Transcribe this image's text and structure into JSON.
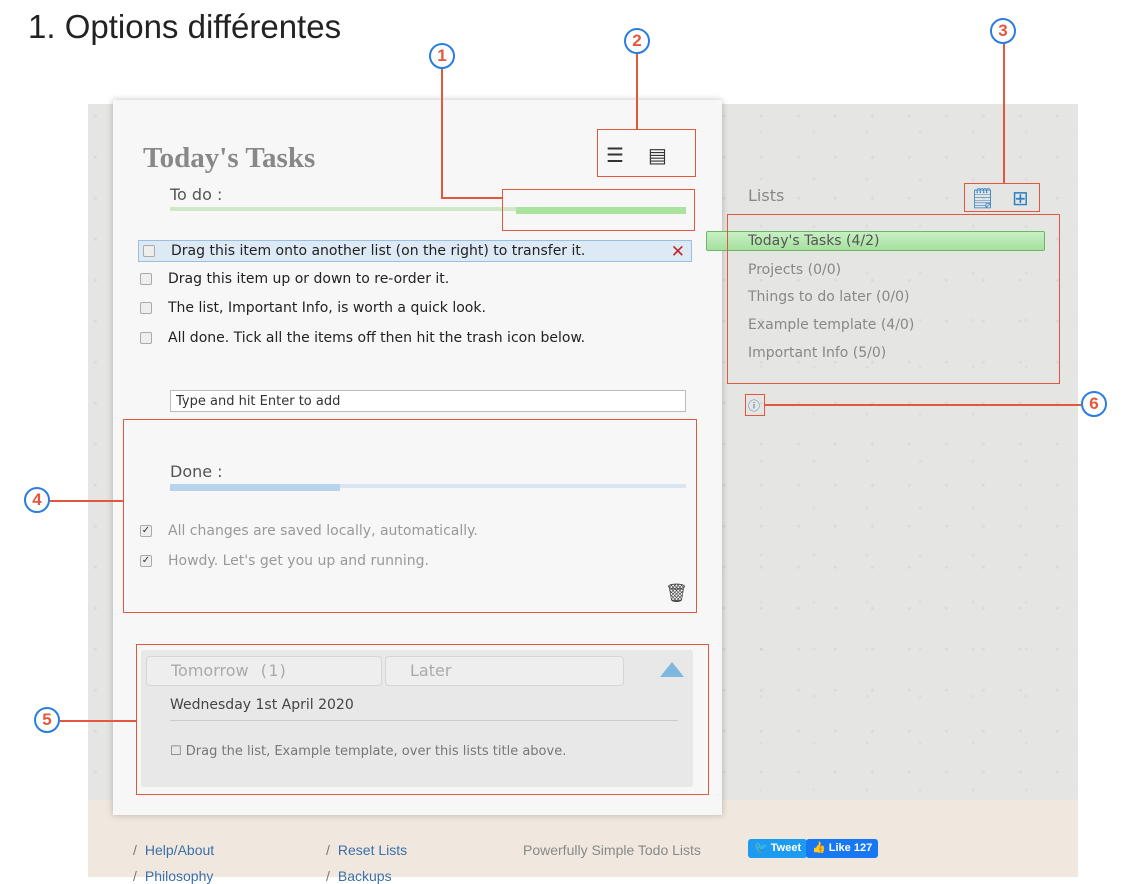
{
  "heading": "1. Options différentes",
  "panel": {
    "title": "Today's Tasks",
    "todo_label": "To do :",
    "done_label": "Done :",
    "todo_items": [
      "Drag this item onto another list (on the right) to transfer it.",
      "Drag this item up or down to re-order it.",
      "The list, Important Info, is worth a quick look.",
      "All done. Tick all the items off then hit the trash icon below."
    ],
    "done_items": [
      "All changes are saved locally, automatically.",
      "Howdy. Let's get you up and running."
    ],
    "add_value": "Type and hit Enter to add"
  },
  "icons": {
    "list_view": "list-view-icon",
    "print_view": "print-view-icon",
    "delete": "close-icon",
    "trash": "trash-icon",
    "info": "info-icon",
    "add_list": "add-list-icon",
    "add_template": "add-template-icon"
  },
  "lists": {
    "header": "Lists",
    "items": [
      "Today's Tasks (4/2)",
      "Projects (0/0)",
      "Things to do later (0/0)",
      "Example template (4/0)",
      "Important Info (5/0)"
    ]
  },
  "schedule": {
    "tab_tomorrow": "Tomorrow",
    "tab_tomorrow_count": "(1)",
    "tab_later": "Later",
    "date": "Wednesday 1st April 2020",
    "item": "Drag the list, Example template, over this lists title above."
  },
  "annotations": [
    "1",
    "2",
    "3",
    "4",
    "5",
    "6"
  ],
  "footer": {
    "help": "Help/About",
    "reset": "Reset Lists",
    "philosophy": "Philosophy",
    "backups": "Backups",
    "tagline": "Powerfully Simple Todo Lists",
    "tweet": "Tweet",
    "like": "Like 127"
  },
  "colors": {
    "accent_annotation": "#e2583e",
    "badge_ring": "#2b7de0",
    "todo_bar": "#a9e39e",
    "done_bar": "#b8d4ec",
    "active_list": "#a6e09f"
  }
}
